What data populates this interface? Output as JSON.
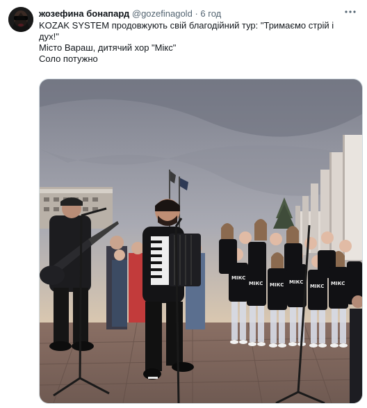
{
  "tweet": {
    "author_name": "жозефина бонапард",
    "author_handle": "@gozefinagold",
    "separator": "·",
    "timestamp": "6 год",
    "more_icon": "more-horizontal-icon",
    "text_lines": [
      "KOZAK SYSTEM продовжують свій благодійний тур: \"Тримаємо стрій і дух!\"",
      "Місто Вараш, дитячий хор \"Мікс\"",
      "Соло потужно"
    ],
    "shirt_text": "МІКС"
  },
  "colors": {
    "text_primary": "#0f1419",
    "text_secondary": "#536471",
    "border": "#cfd9de"
  }
}
